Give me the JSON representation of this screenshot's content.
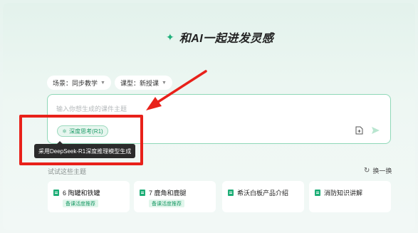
{
  "header": {
    "title": "和AI一起进发灵感",
    "icon": "sparkle-icon"
  },
  "filters": {
    "scene": "场景：同步教学",
    "lesson_type": "课型：新授课"
  },
  "input": {
    "placeholder": "输入你想生成的课件主题",
    "value": ""
  },
  "deep_think": {
    "label": "深度思考(R1)"
  },
  "tooltip": {
    "text": "采用DeepSeek-R1深度推理模型生成"
  },
  "suggestions": {
    "label": "试试这些主题",
    "refresh_label": "换一换",
    "items": [
      {
        "name": "6 陶罐和铁罐",
        "tag": "备课活度推荐"
      },
      {
        "name": "7 鹿角和鹿腿",
        "tag": "备课活度推荐"
      },
      {
        "name": "希沃白板产品介绍",
        "tag": ""
      },
      {
        "name": "消防知识讲解",
        "tag": ""
      }
    ]
  },
  "colors": {
    "accent": "#1fae77",
    "annotation": "#e8211a"
  }
}
